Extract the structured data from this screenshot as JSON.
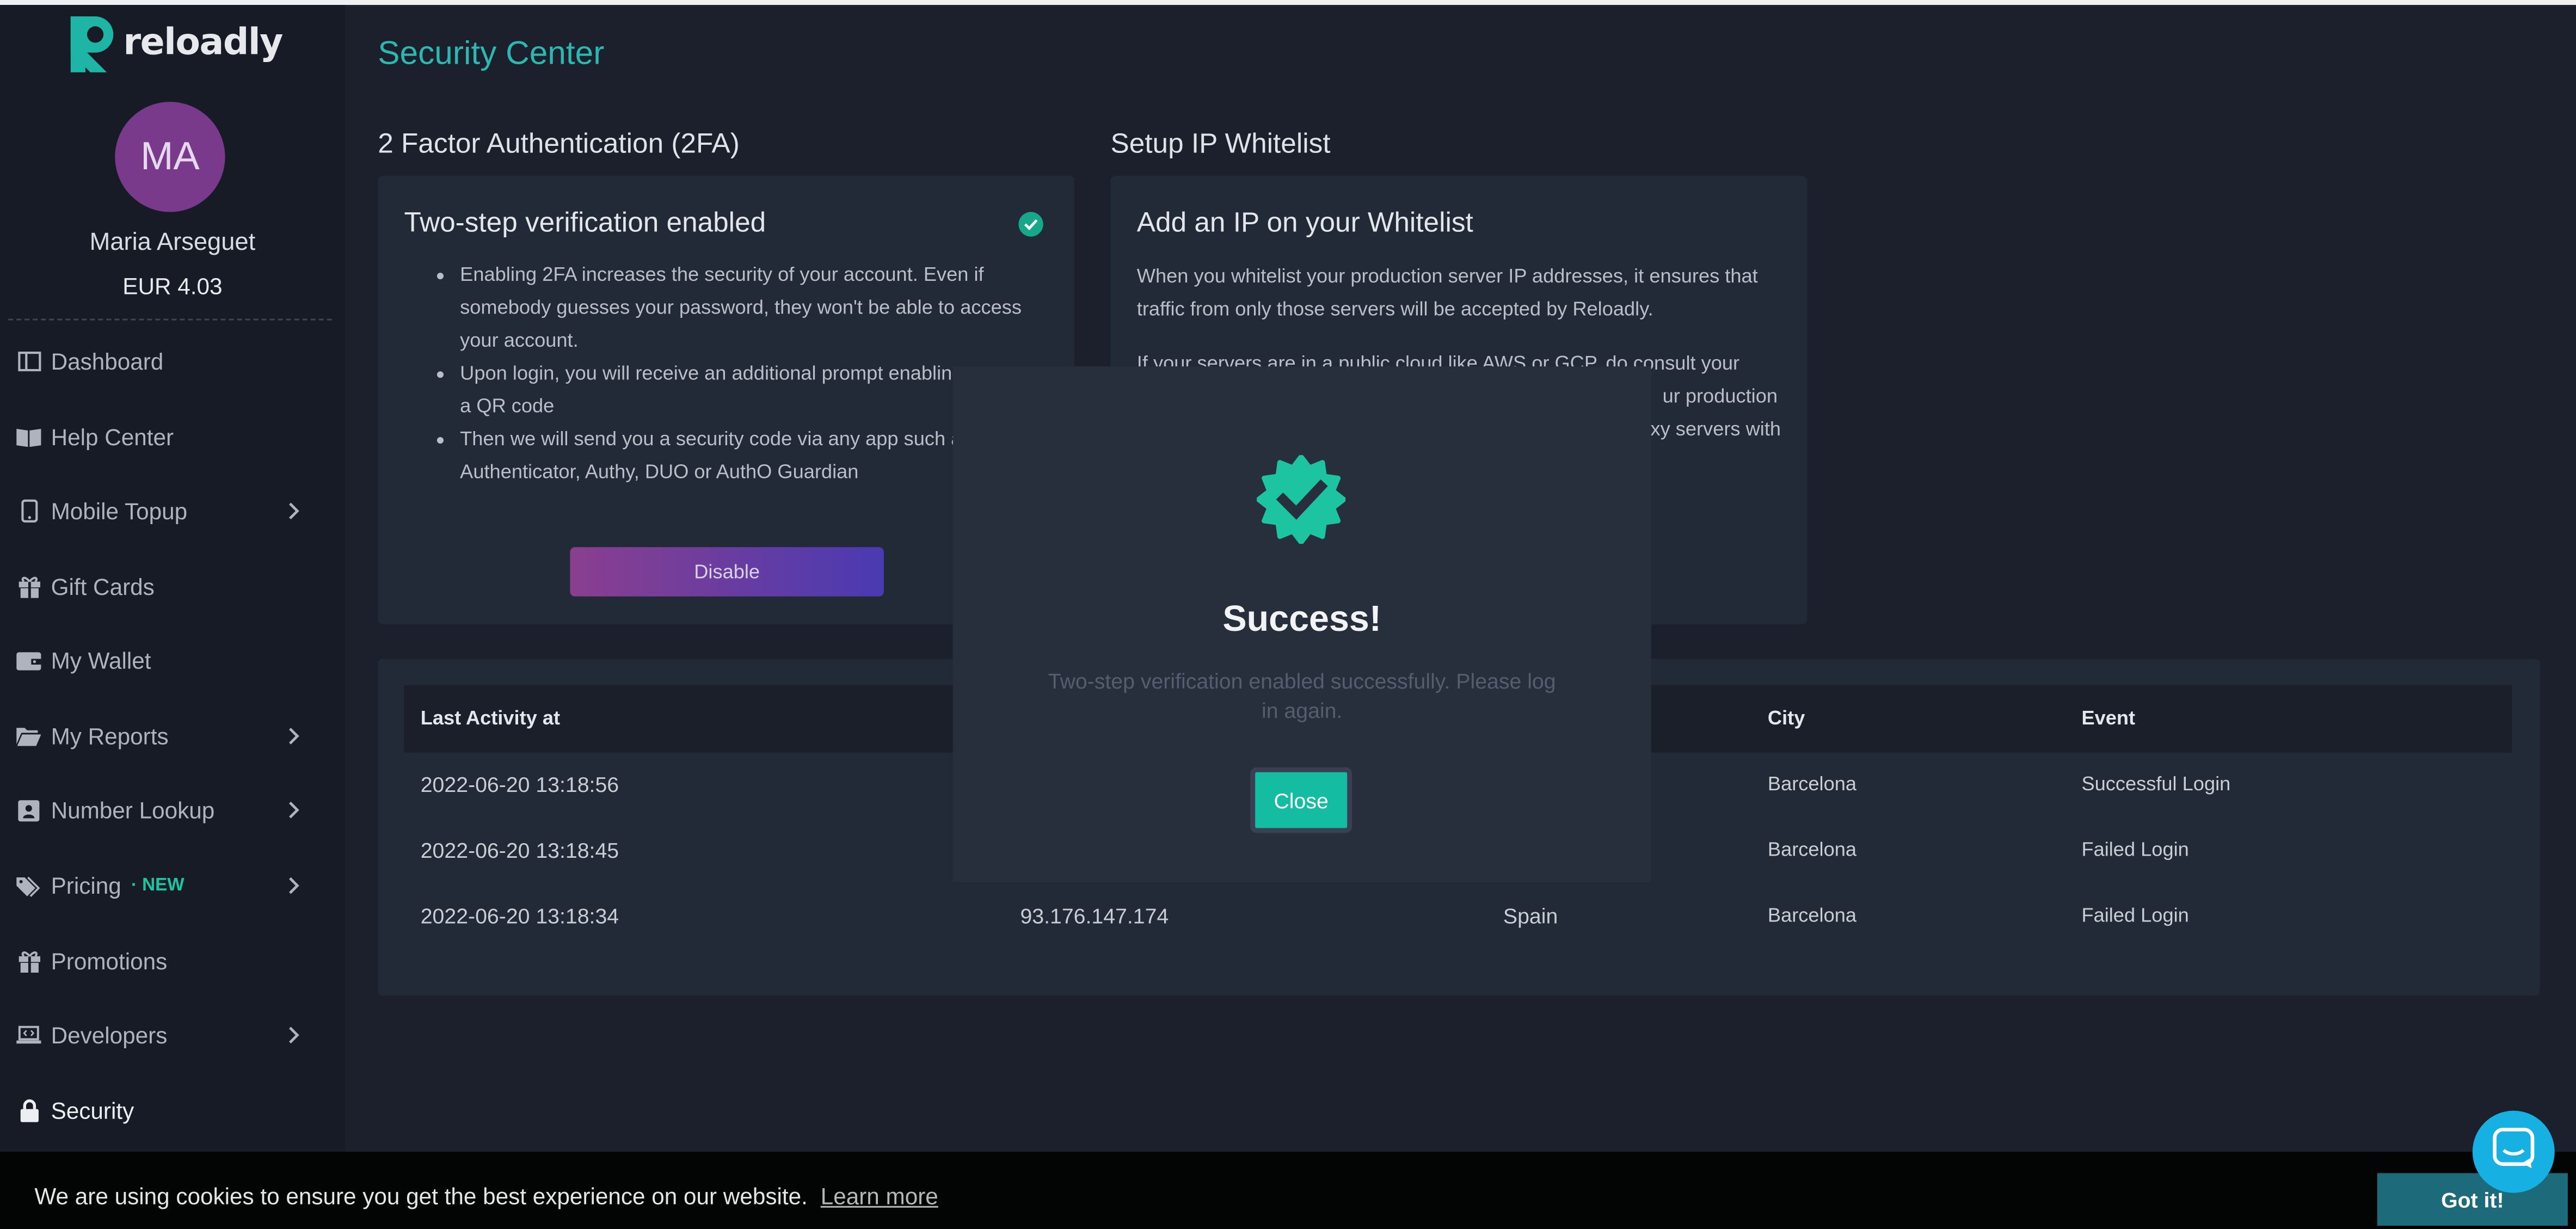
{
  "brand": {
    "name": "reloadly",
    "accent": "#1dc4a2",
    "title_color": "#2cb8b0"
  },
  "user": {
    "initials": "MA",
    "name": "Maria Arseguet",
    "balance": "EUR 4.03"
  },
  "sidebar": {
    "items": [
      {
        "label": "Dashboard",
        "icon": "dashboard-icon"
      },
      {
        "label": "Help Center",
        "icon": "book-icon"
      },
      {
        "label": "Mobile Topup",
        "icon": "mobile-icon"
      },
      {
        "label": "Gift Cards",
        "icon": "gift-icon"
      },
      {
        "label": "My Wallet",
        "icon": "wallet-icon"
      },
      {
        "label": "My Reports",
        "icon": "folder-icon"
      },
      {
        "label": "Number Lookup",
        "icon": "id-card-icon"
      },
      {
        "label": "Pricing",
        "icon": "tags-icon",
        "badge": "· NEW"
      },
      {
        "label": "Promotions",
        "icon": "gift-icon"
      },
      {
        "label": "Developers",
        "icon": "laptop-code-icon"
      },
      {
        "label": "Security",
        "icon": "lock-icon"
      }
    ]
  },
  "page": {
    "title": "Security Center"
  },
  "twofa": {
    "heading": "2 Factor Authentication (2FA)",
    "card_title": "Two-step verification enabled",
    "bullets": [
      "Enabling 2FA increases the security of your account. Even if somebody guesses your password, they won't be able to access your account.",
      "Upon login, you will receive an additional prompt enabling to scan a QR code",
      "Then we will send you a security code via any app such as Authenticator, Authy, DUO or AuthO Guardian"
    ],
    "disable_label": "Disable"
  },
  "whitelist": {
    "heading": "Setup IP Whitelist",
    "card_title": "Add an IP on your Whitelist",
    "para1": "When you whitelist your production server IP addresses, it ensures that traffic from only those servers will be accepted by Reloadly.",
    "para2_line1": "If your servers are in a public cloud like AWS or GCP, do consult your cloud",
    "para2_line2": "ur production",
    "para2_line3": "oxy servers with"
  },
  "activity": {
    "headers": {
      "last_activity": "Last Activity at",
      "city": "City",
      "event": "Event"
    },
    "rows": [
      {
        "time": "2022-06-20 13:18:56",
        "ip": "",
        "country": "",
        "city": "Barcelona",
        "event": "Successful Login"
      },
      {
        "time": "2022-06-20 13:18:45",
        "ip": "",
        "country": "",
        "city": "Barcelona",
        "event": "Failed Login"
      },
      {
        "time": "2022-06-20 13:18:34",
        "ip": "93.176.147.174",
        "country": "Spain",
        "city": "Barcelona",
        "event": "Failed Login"
      }
    ]
  },
  "modal": {
    "title": "Success!",
    "message": "Two-step verification enabled successfully. Please log in again.",
    "close_label": "Close"
  },
  "cookie": {
    "text": "We are using cookies to ensure you get the best experience on our website.",
    "link": "Learn more",
    "button": "Got it!"
  },
  "chat": {
    "icon": "chat-icon"
  }
}
